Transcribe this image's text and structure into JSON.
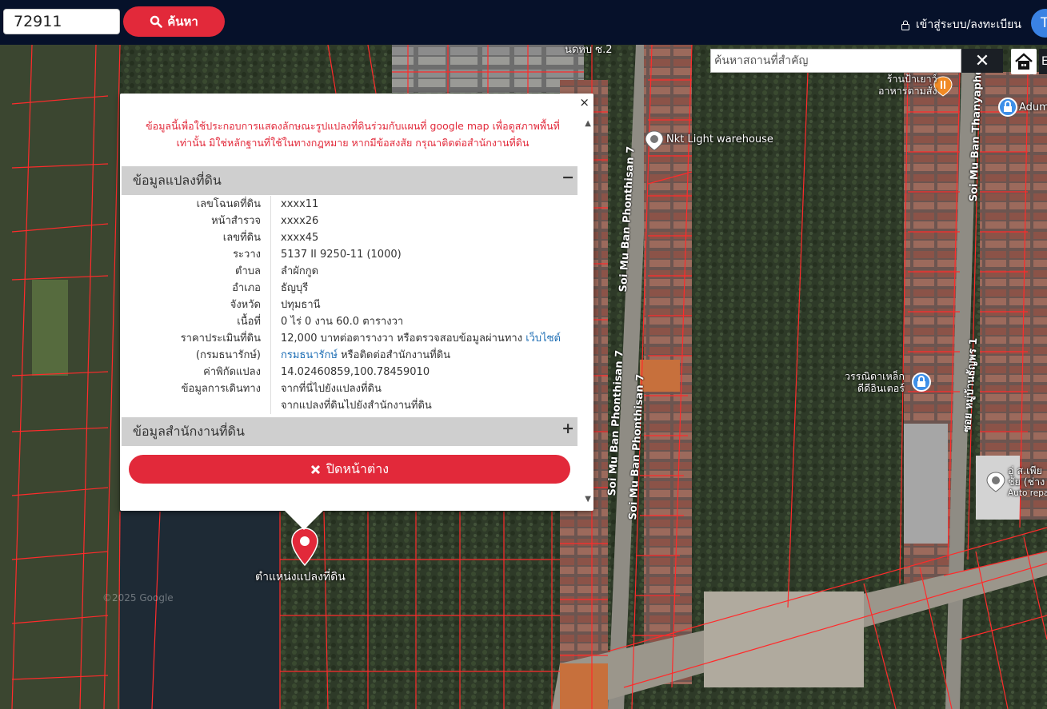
{
  "topbar": {
    "parcel_number": "72911",
    "search_label": "ค้นหา",
    "login_label": "เข้าสู่ระบบ/ลงทะเบียน",
    "user_initial": "T"
  },
  "map_search": {
    "placeholder": "ค้นหาสถานที่สำคัญ",
    "clear_symbol": "✕",
    "extra_symbol": "E"
  },
  "map_labels": {
    "warehouse": "Nkt Light warehouse",
    "restaurant_line1": "ร้านป้าเยาว์",
    "restaurant_line2": "อาหารตามสั่ง",
    "adum": "Adum",
    "steel_shop_line1": "วรรณิดาเหล็ก",
    "steel_shop_line2": "ดีดีอินเตอร์",
    "repair_line1": "อู่ ส.เพีย",
    "repair_line2": "ชัย (ช่าง",
    "repair_line3": "Auto repa",
    "top_place": "นดหบ ซ.2",
    "road_phonthisan_a": "Soi Mu Ban Phonthisan 7",
    "road_phonthisan_b": "Soi Mu Ban Phonthisan 7",
    "road_phonthisan_c": "Soi Mu Ban Phonthisan 7",
    "road_thanyaphon_en": "Soi Mu Ban Thanyaphon 1",
    "road_thanyaphon_th": "ซอย หมู่บ้านธัญพร 1",
    "google_watermark": "©2025 Google",
    "marker_label": "ตำแหน่งแปลงที่ดิน"
  },
  "popup": {
    "close_symbol": "×",
    "disclaimer_line1": "ข้อมูลนี้เพื่อใช้ประกอบการแสดงลักษณะรูปแปลงที่ดินร่วมกับแผนที่ google map เพื่อดูสภาพพื้นที่",
    "disclaimer_line2": "เท่านั้น มิใช่หลักฐานที่ใช้ในทางกฎหมาย หากมีข้อสงสัย กรุณาติดต่อสำนักงานที่ดิน",
    "section_parcel": "ข้อมูลแปลงที่ดิน",
    "section_parcel_toggle": "−",
    "section_office": "ข้อมูลสำนักงานที่ดิน",
    "section_office_toggle": "+",
    "close_window_label": "ปิดหน้าต่าง",
    "rows": [
      {
        "label": "เลขโฉนดที่ดิน",
        "value": "xxxx11"
      },
      {
        "label": "หน้าสำรวจ",
        "value": "xxxx26"
      },
      {
        "label": "เลขที่ดิน",
        "value": "xxxx45"
      },
      {
        "label": "ระวาง",
        "value": "5137 II 9250-11 (1000)"
      },
      {
        "label": "ตำบล",
        "value": "ลำผักกูด"
      },
      {
        "label": "อำเภอ",
        "value": "ธัญบุรี"
      },
      {
        "label": "จังหวัด",
        "value": "ปทุมธานี"
      },
      {
        "label": "เนื้อที่",
        "value": "0 ไร่ 0 งาน 60.0 ตารางวา"
      }
    ],
    "price_label_line1": "ราคาประเมินที่ดิน",
    "price_label_line2": "(กรมธนารักษ์)",
    "price_text": "12,000 บาทต่อตารางวา หรือตรวจสอบข้อมูลผ่านทาง",
    "price_link_a": "เว็บไซต์",
    "price_link_b": "กรมธนารักษ์",
    "price_text_tail": "หรือติดต่อสำนักงานที่ดิน",
    "coord_label": "ค่าพิกัดแปลง",
    "coord_value": "14.02460859,100.78459010",
    "travel_label": "ข้อมูลการเดินทาง",
    "travel_link_1": "จากที่นี่ไปยังแปลงที่ดิน",
    "travel_link_2": "จากแปลงที่ดินไปยังสำนักงานที่ดิน"
  }
}
